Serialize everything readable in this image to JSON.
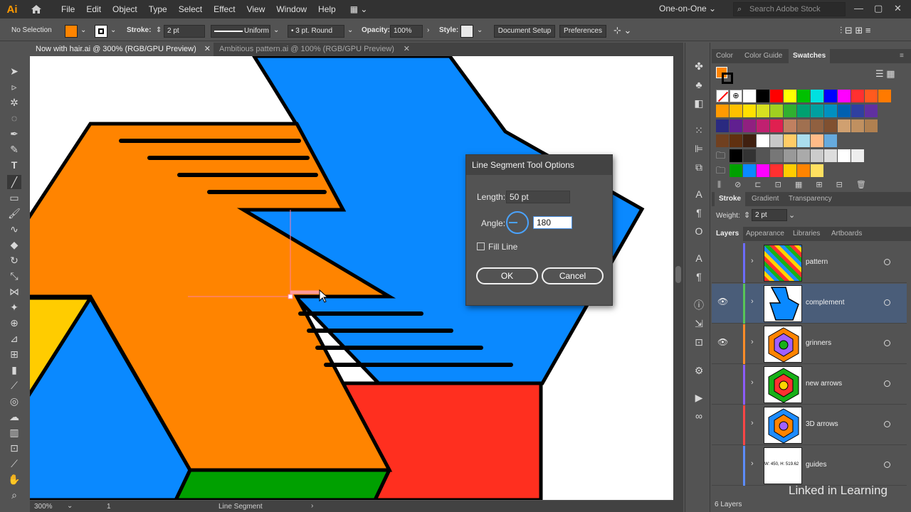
{
  "app": {
    "logo": "Ai",
    "menu": [
      "File",
      "Edit",
      "Object",
      "Type",
      "Select",
      "Effect",
      "View",
      "Window",
      "Help"
    ],
    "workspace": "One-on-One",
    "search_placeholder": "Search Adobe Stock"
  },
  "controlbar": {
    "selection": "No Selection",
    "stroke_label": "Stroke:",
    "stroke_weight": "2 pt",
    "profile": "Uniform",
    "brush": "3 pt. Round",
    "opacity_label": "Opacity:",
    "opacity": "100%",
    "style_label": "Style:",
    "document_setup": "Document Setup",
    "preferences": "Preferences",
    "fill_color": "#ff8400"
  },
  "tabs": [
    {
      "label": "Now with hair.ai @ 300% (RGB/GPU Preview)",
      "active": true
    },
    {
      "label": "Ambitious pattern.ai @ 100% (RGB/GPU Preview)",
      "active": false
    }
  ],
  "dialog": {
    "title": "Line Segment Tool Options",
    "length_label": "Length:",
    "length_value": "50 pt",
    "angle_label": "Angle:",
    "angle_value": "180",
    "fill_line_label": "Fill Line",
    "ok_label": "OK",
    "cancel_label": "Cancel"
  },
  "statusbar": {
    "zoom": "300%",
    "artboard": "1",
    "tool": "Line Segment"
  },
  "panels": {
    "top_tabs": [
      "Color",
      "Color Guide",
      "Swatches"
    ],
    "stroke_tabs": [
      "Stroke",
      "Gradient",
      "Transparency"
    ],
    "weight_label": "Weight:",
    "weight_value": "2 pt",
    "layers_tabs": [
      "Layers",
      "Appearance",
      "Libraries",
      "Artboards"
    ],
    "layers": [
      {
        "name": "pattern",
        "color": "#6c6cff",
        "visible": false,
        "selected": false
      },
      {
        "name": "complement",
        "color": "#58c458",
        "visible": true,
        "selected": true
      },
      {
        "name": "grinners",
        "color": "#ff8c28",
        "visible": true,
        "selected": false
      },
      {
        "name": "new arrows",
        "color": "#8c5cff",
        "visible": false,
        "selected": false
      },
      {
        "name": "3D arrows",
        "color": "#ff4646",
        "visible": false,
        "selected": false
      },
      {
        "name": "guides",
        "color": "#5c8cff",
        "visible": false,
        "selected": false
      }
    ],
    "guides_thumb_text": "W: 450, H: 519.62",
    "layers_count": "6 Layers"
  },
  "watermark": "Linked in Learning"
}
